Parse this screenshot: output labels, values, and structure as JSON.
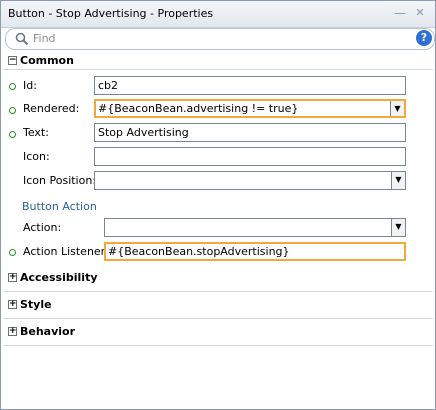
{
  "window": {
    "title": "Button - Stop Advertising - Properties",
    "minimize_glyph": "—",
    "close_glyph": "✕"
  },
  "search": {
    "placeholder": "Find",
    "value": "",
    "help_label": "?"
  },
  "sections": {
    "common": {
      "label": "Common",
      "toggle": "−",
      "fields": {
        "id": {
          "label": "Id:",
          "value": "cb2"
        },
        "rendered": {
          "label": "Rendered:",
          "value": "#{BeaconBean.advertising != true}"
        },
        "text": {
          "label": "Text:",
          "value": "Stop Advertising"
        },
        "icon": {
          "label": "Icon:",
          "value": ""
        },
        "icon_position": {
          "label": "Icon Position:",
          "value": ""
        }
      },
      "button_action": {
        "label": "Button Action",
        "fields": {
          "action": {
            "label": "Action:",
            "value": ""
          },
          "action_listener": {
            "label": "Action Listener:",
            "value": "#{BeaconBean.stopAdvertising}"
          }
        }
      }
    },
    "accessibility": {
      "label": "Accessibility",
      "toggle": "+"
    },
    "style": {
      "label": "Style",
      "toggle": "+"
    },
    "behavior": {
      "label": "Behavior",
      "toggle": "+"
    }
  },
  "colors": {
    "required_indicator": "#2e8b2e",
    "focus_border": "#f0a93a",
    "subsection_text": "#2c5e9e",
    "help_icon": "#2f6fd1"
  },
  "icons": {
    "search": "search-icon",
    "help": "help-icon",
    "dropdown": "chevron-down-icon",
    "required": "required-indicator-icon"
  }
}
